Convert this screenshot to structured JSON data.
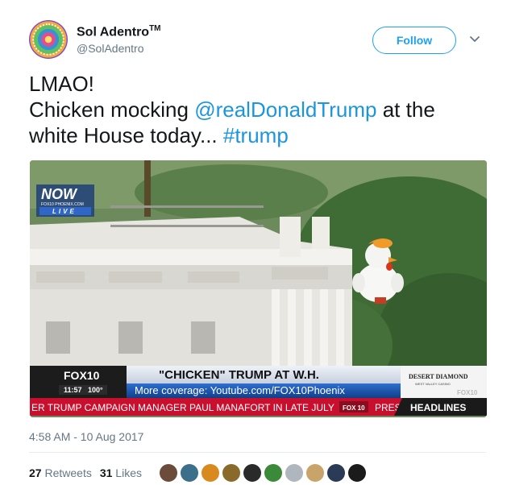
{
  "author": {
    "name": "Sol Adentro",
    "trademark": "TM",
    "handle": "@SolAdentro"
  },
  "follow_button": {
    "label": "Follow"
  },
  "tweet": {
    "line1": "LMAO!",
    "line2_prefix": "Chicken mocking ",
    "mention": "@realDonaldTrump",
    "line2_suffix": " at the",
    "line3_prefix": "white House today... ",
    "hashtag": "#trump"
  },
  "media": {
    "live_badge": {
      "logo": "NOW",
      "sublabel": "FOX10 PHOENIX.COM",
      "live": "LIVE"
    },
    "ticker": {
      "channel": "FOX10",
      "time": "11:57",
      "temp": "100°",
      "headline": "\"CHICKEN\" TRUMP AT W.H.",
      "subline": "More coverage: Youtube.com/FOX10Phoenix",
      "crawl": "ER TRUMP CAMPAIGN MANAGER PAUL MANAFORT IN LATE JULY",
      "crawl_channel": "FOX 10",
      "crawl_tail": "PRES",
      "headlines": "HEADLINES",
      "sponsor": "DESERT DIAMOND",
      "sponsor_sub": "WEST VALLEY CASINO",
      "sponsor_fox": "FOX10"
    }
  },
  "meta": {
    "timestamp": "4:58 AM - 10 Aug 2017"
  },
  "stats": {
    "retweets_count": "27",
    "retweets_label": "Retweets",
    "likes_count": "31",
    "likes_label": "Likes"
  },
  "colors": {
    "link": "#1b95e0",
    "follow": "#1da1f2",
    "muted": "#657786"
  },
  "icons": {
    "caret": "chevron-down-icon"
  }
}
